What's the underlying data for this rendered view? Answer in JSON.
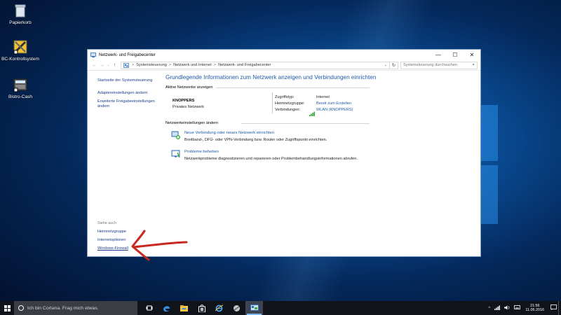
{
  "desktop": {
    "icons": [
      {
        "label": "Papierkorb",
        "icon": "recycle-bin-icon"
      },
      {
        "label": "BC-Kontrollsystem",
        "icon": "bc-kontrollsystem-icon"
      },
      {
        "label": "Bistro-Cash",
        "icon": "bistro-cash-icon"
      }
    ]
  },
  "window": {
    "title": "Netzwerk- und Freigabecenter",
    "controls": {
      "minimize": "—",
      "maximize": "☐",
      "close": "✕"
    },
    "address": {
      "back": "←",
      "forward": "→",
      "recent": "⌄",
      "up": "↑",
      "crumbs": [
        "Systemsteuerung",
        "Netzwerk und Internet",
        "Netzwerk- und Freigabecenter"
      ],
      "separator": ">",
      "dropdown": "⌄",
      "refresh": "↻",
      "search_placeholder": "Systemsteuerung durchsuchen",
      "search_icon": "search-icon"
    },
    "sidebar": {
      "links": [
        "Startseite der Systemsteuerung",
        "Adaptereinstellungen ändern",
        "Erweiterte Freigabeeinstellungen ändern"
      ],
      "see_also_label": "Siehe auch",
      "see_also": [
        "Heimnetzgruppe",
        "Internetoptionen",
        "Windows-Firewall"
      ]
    },
    "main": {
      "heading": "Grundlegende Informationen zum Netzwerk anzeigen und Verbindungen einrichten",
      "active_label": "Aktive Netzwerke anzeigen",
      "network_name": "KNOPPERS",
      "network_type": "Privates Netzwerk",
      "access_type_label": "Zugriffstyp:",
      "access_type_value": "Internet",
      "homegroup_label": "Heimnetzgruppe:",
      "homegroup_value": "Bereit zum Erstellen",
      "connections_label": "Verbindungen:",
      "connections_value": "WLAN (KNOPPERS)",
      "settings_label": "Netzwerkeinstellungen ändern",
      "tasks": [
        {
          "title": "Neue Verbindung oder neues Netzwerk einrichten",
          "desc": "Breitband-, DFÜ- oder VPN-Verbindung bzw. Router oder Zugriffspunkt einrichten.",
          "icon": "new-connection-icon"
        },
        {
          "title": "Probleme beheben",
          "desc": "Netzwerkprobleme diagnostizieren und reparieren oder Problembehandlungsinformationen abrufen.",
          "icon": "troubleshoot-icon"
        }
      ]
    }
  },
  "taskbar": {
    "cortana_placeholder": "Ich bin Cortana. Frag mich etwas.",
    "apps": [
      "task-view-icon",
      "edge-icon",
      "file-explorer-icon",
      "store-icon",
      "internet-explorer-icon",
      "app-icon",
      "control-panel-icon"
    ],
    "clock_time": "21:56",
    "clock_date": "11.06.2016"
  },
  "colors": {
    "link": "#1e5aa8",
    "annotation_arrow": "#c8281e",
    "taskbar": "#101319"
  }
}
